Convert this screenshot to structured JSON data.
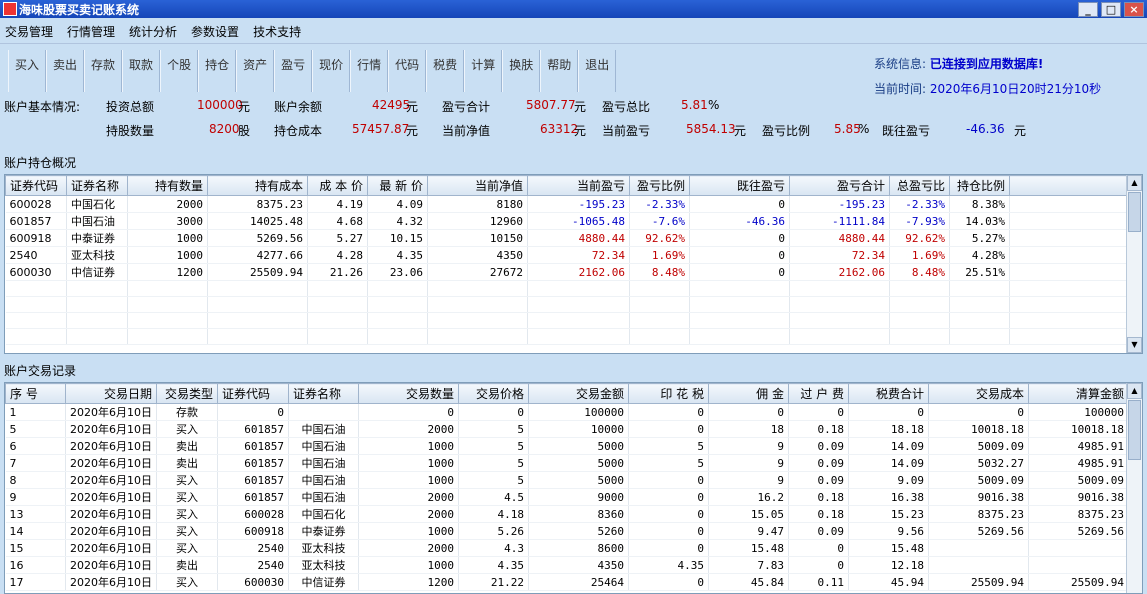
{
  "window": {
    "title": "海味股票买卖记账系统"
  },
  "menu": [
    "交易管理",
    "行情管理",
    "统计分析",
    "参数设置",
    "技术支持"
  ],
  "toolbar": [
    {
      "label": "买入",
      "name": "buy"
    },
    {
      "label": "卖出",
      "name": "sell"
    },
    {
      "label": "存款",
      "name": "deposit"
    },
    {
      "label": "取款",
      "name": "withdraw"
    },
    {
      "label": "个股",
      "name": "stock"
    },
    {
      "label": "持仓",
      "name": "holdings"
    },
    {
      "label": "资产",
      "name": "assets"
    },
    {
      "label": "盈亏",
      "name": "profit-loss"
    },
    {
      "label": "现价",
      "name": "current-price"
    },
    {
      "label": "行情",
      "name": "market"
    },
    {
      "label": "代码",
      "name": "code"
    },
    {
      "label": "税费",
      "name": "tax-fee"
    },
    {
      "label": "计算",
      "name": "calculate"
    },
    {
      "label": "换肤",
      "name": "skin"
    },
    {
      "label": "帮助",
      "name": "help"
    },
    {
      "label": "退出",
      "name": "exit"
    }
  ],
  "system": {
    "info_label": "系统信息:",
    "info_value": "已连接到应用数据库!",
    "time_label": "当前时间:",
    "time_value": "2020年6月10日20时21分10秒"
  },
  "summary": {
    "title": "账户基本情况:",
    "total_invest_label": "投资总额",
    "total_invest": "100000",
    "unit_yuan": "元",
    "balance_label": "账户余额",
    "balance": "42495",
    "pnl_total_label": "盈亏合计",
    "pnl_total": "5807.77",
    "pnl_ratio_label": "盈亏总比",
    "pnl_ratio": "5.81",
    "percent": "%",
    "shares_label": "持股数量",
    "shares": "8200",
    "unit_share": "股",
    "cost_label": "持仓成本",
    "cost": "57457.87",
    "net_label": "当前净值",
    "net": "63312",
    "cur_pnl_label": "当前盈亏",
    "cur_pnl": "5854.13",
    "pnl_pct_label": "盈亏比例",
    "pnl_pct": "5.85",
    "past_pnl_label": "既往盈亏",
    "past_pnl": "-46.36"
  },
  "holdings": {
    "label": "账户持仓概况",
    "columns": [
      "证券代码",
      "证券名称",
      "持有数量",
      "持有成本",
      "成 本 价",
      "最 新 价",
      "当前净值",
      "当前盈亏",
      "盈亏比例",
      "既往盈亏",
      "盈亏合计",
      "总盈亏比",
      "持仓比例"
    ],
    "rows": [
      [
        "600028",
        "中国石化",
        "2000",
        "8375.23",
        "4.19",
        "4.09",
        "8180",
        "-195.23",
        "-2.33%",
        "0",
        "-195.23",
        "-2.33%",
        "8.38%"
      ],
      [
        "601857",
        "中国石油",
        "3000",
        "14025.48",
        "4.68",
        "4.32",
        "12960",
        "-1065.48",
        "-7.6%",
        "-46.36",
        "-1111.84",
        "-7.93%",
        "14.03%"
      ],
      [
        "600918",
        "中泰证券",
        "1000",
        "5269.56",
        "5.27",
        "10.15",
        "10150",
        "4880.44",
        "92.62%",
        "0",
        "4880.44",
        "92.62%",
        "5.27%"
      ],
      [
        "2540",
        "亚太科技",
        "1000",
        "4277.66",
        "4.28",
        "4.35",
        "4350",
        "72.34",
        "1.69%",
        "0",
        "72.34",
        "1.69%",
        "4.28%"
      ],
      [
        "600030",
        "中信证券",
        "1200",
        "25509.94",
        "21.26",
        "23.06",
        "27672",
        "2162.06",
        "8.48%",
        "0",
        "2162.06",
        "8.48%",
        "25.51%"
      ]
    ]
  },
  "trades": {
    "label": "账户交易记录",
    "columns": [
      "序  号",
      "交易日期",
      "交易类型",
      "证券代码",
      "证券名称",
      "交易数量",
      "交易价格",
      "交易金额",
      "印 花 税",
      "佣   金",
      "过 户 费",
      "税费合计",
      "交易成本",
      "清算金额"
    ],
    "rows": [
      [
        "1",
        "2020年6月10日",
        "存款",
        "0",
        "",
        "0",
        "0",
        "100000",
        "0",
        "0",
        "0",
        "0",
        "0",
        "100000"
      ],
      [
        "5",
        "2020年6月10日",
        "买入",
        "601857",
        "中国石油",
        "2000",
        "5",
        "10000",
        "0",
        "18",
        "0.18",
        "18.18",
        "10018.18",
        "10018.18"
      ],
      [
        "6",
        "2020年6月10日",
        "卖出",
        "601857",
        "中国石油",
        "1000",
        "5",
        "5000",
        "5",
        "9",
        "0.09",
        "14.09",
        "5009.09",
        "4985.91"
      ],
      [
        "7",
        "2020年6月10日",
        "卖出",
        "601857",
        "中国石油",
        "1000",
        "5",
        "5000",
        "5",
        "9",
        "0.09",
        "14.09",
        "5032.27",
        "4985.91"
      ],
      [
        "8",
        "2020年6月10日",
        "买入",
        "601857",
        "中国石油",
        "1000",
        "5",
        "5000",
        "0",
        "9",
        "0.09",
        "9.09",
        "5009.09",
        "5009.09"
      ],
      [
        "9",
        "2020年6月10日",
        "买入",
        "601857",
        "中国石油",
        "2000",
        "4.5",
        "9000",
        "0",
        "16.2",
        "0.18",
        "16.38",
        "9016.38",
        "9016.38"
      ],
      [
        "13",
        "2020年6月10日",
        "买入",
        "600028",
        "中国石化",
        "2000",
        "4.18",
        "8360",
        "0",
        "15.05",
        "0.18",
        "15.23",
        "8375.23",
        "8375.23"
      ],
      [
        "14",
        "2020年6月10日",
        "买入",
        "600918",
        "中泰证券",
        "1000",
        "5.26",
        "5260",
        "0",
        "9.47",
        "0.09",
        "9.56",
        "5269.56",
        "5269.56"
      ],
      [
        "15",
        "2020年6月10日",
        "买入",
        "2540",
        "亚太科技",
        "2000",
        "4.3",
        "8600",
        "0",
        "15.48",
        "0",
        "15.48",
        "",
        ""
      ],
      [
        "16",
        "2020年6月10日",
        "卖出",
        "2540",
        "亚太科技",
        "1000",
        "4.35",
        "4350",
        "4.35",
        "7.83",
        "0",
        "12.18",
        "",
        ""
      ],
      [
        "17",
        "2020年6月10日",
        "买入",
        "600030",
        "中信证券",
        "1200",
        "21.22",
        "25464",
        "0",
        "45.84",
        "0.11",
        "45.94",
        "25509.94",
        "25509.94"
      ]
    ]
  },
  "colors": {
    "positive": "#c00000",
    "negative": "#0000c8",
    "title_bar": "#1f55c8"
  }
}
